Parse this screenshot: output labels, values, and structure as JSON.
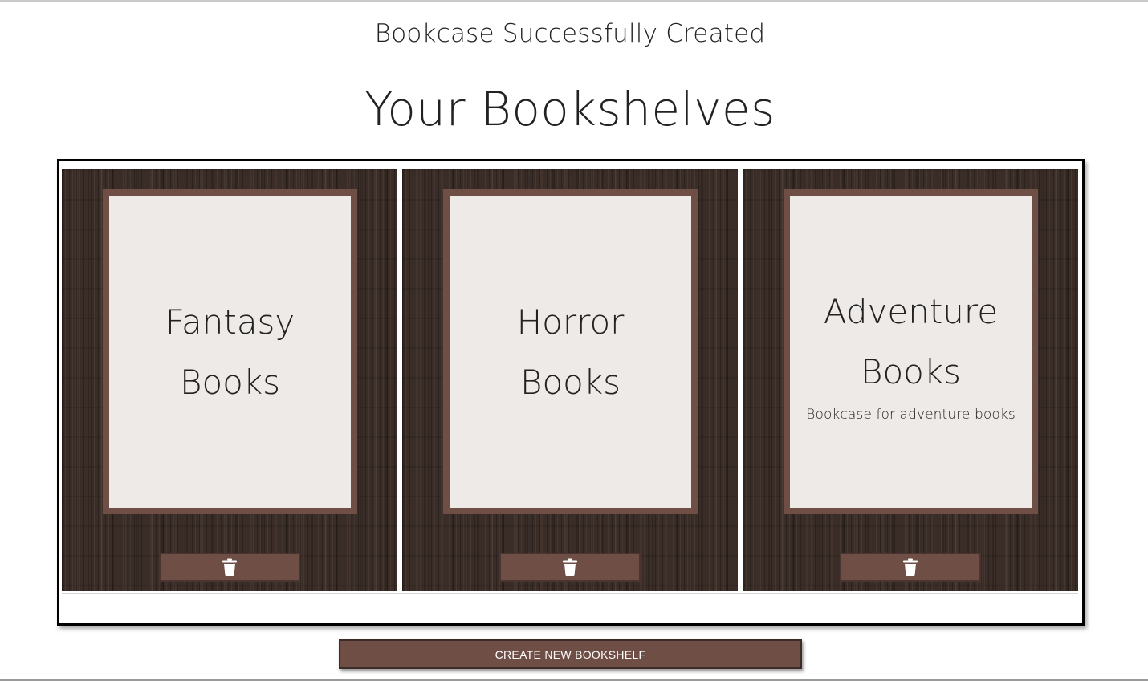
{
  "flash_message": "Bookcase Successfully Created",
  "page_title": "Your Bookshelves",
  "bookshelves": [
    {
      "title": "Fantasy Books",
      "description": ""
    },
    {
      "title": "Horror Books",
      "description": ""
    },
    {
      "title": "Adventure Books",
      "description": "Bookcase for adventure books"
    }
  ],
  "icons": {
    "delete": "trash-icon"
  },
  "colors": {
    "accent": "#6f4e45",
    "card_background": "#eeeae7",
    "wood": "#3a2d27"
  },
  "actions": {
    "create_label": "CREATE NEW BOOKSHELF"
  }
}
